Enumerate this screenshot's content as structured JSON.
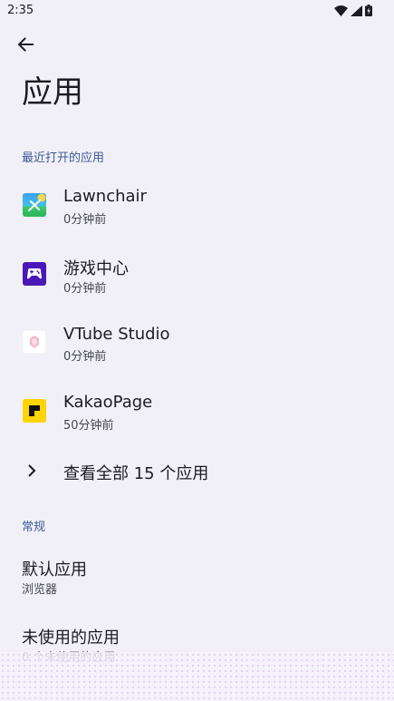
{
  "status_bar": {
    "time": "2:35",
    "icons": [
      "wifi-icon",
      "signal-icon",
      "battery-icon"
    ]
  },
  "header": {
    "back_icon": "arrow-back-icon",
    "title": "应用"
  },
  "recent": {
    "section_label": "最近打开的应用",
    "apps": [
      {
        "name": "Lawnchair",
        "subtitle": "0分钟前",
        "icon": "lawnchair-icon"
      },
      {
        "name": "游戏中心",
        "subtitle": "0分钟前",
        "icon": "game-center-icon"
      },
      {
        "name": "VTube Studio",
        "subtitle": "0分钟前",
        "icon": "vtube-studio-icon"
      },
      {
        "name": "KakaoPage",
        "subtitle": "50分钟前",
        "icon": "kakaopage-icon"
      }
    ],
    "see_all_label": "查看全部 15 个应用",
    "see_all_icon": "chevron-right-icon"
  },
  "general": {
    "section_label": "常规",
    "items": [
      {
        "title": "默认应用",
        "subtitle": "浏览器"
      },
      {
        "title": "未使用的应用",
        "subtitle": "0 个未使用的应用"
      }
    ]
  },
  "colors": {
    "background": "#f1f0f7",
    "accent": "#3d5a98",
    "text_primary": "#1b1b21",
    "text_secondary": "#45464f"
  }
}
